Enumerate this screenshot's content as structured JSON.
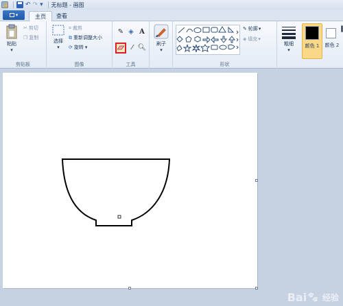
{
  "title_bar": {
    "title": "无标题 - 画图"
  },
  "tabs": [
    {
      "label": "主页",
      "active": true
    },
    {
      "label": "查看",
      "active": false
    }
  ],
  "ribbon": {
    "clipboard": {
      "paste": "粘贴",
      "cut": "剪切",
      "copy": "复制",
      "group": "剪贴板"
    },
    "image": {
      "select": "选择",
      "crop": "裁剪",
      "resize": "重新调整大小",
      "rotate": "旋转",
      "group": "图像"
    },
    "tools": {
      "group": "工具",
      "selected_tool": "eraser"
    },
    "brushes": {
      "label": "刷子"
    },
    "shapes": {
      "outline": "轮廓",
      "fill": "填充",
      "group": "形状"
    },
    "size": {
      "label": "粗细"
    },
    "color1": {
      "label": "颜色 1",
      "value": "#000000"
    },
    "color2": {
      "label": "颜色 2",
      "value": "#ffffff"
    }
  },
  "colors": {
    "accent": "#d9202a",
    "canvas": "#ffffff",
    "workspace": "#c6d1e2"
  },
  "watermark": {
    "brand": "Bai",
    "brand2": "经验"
  }
}
